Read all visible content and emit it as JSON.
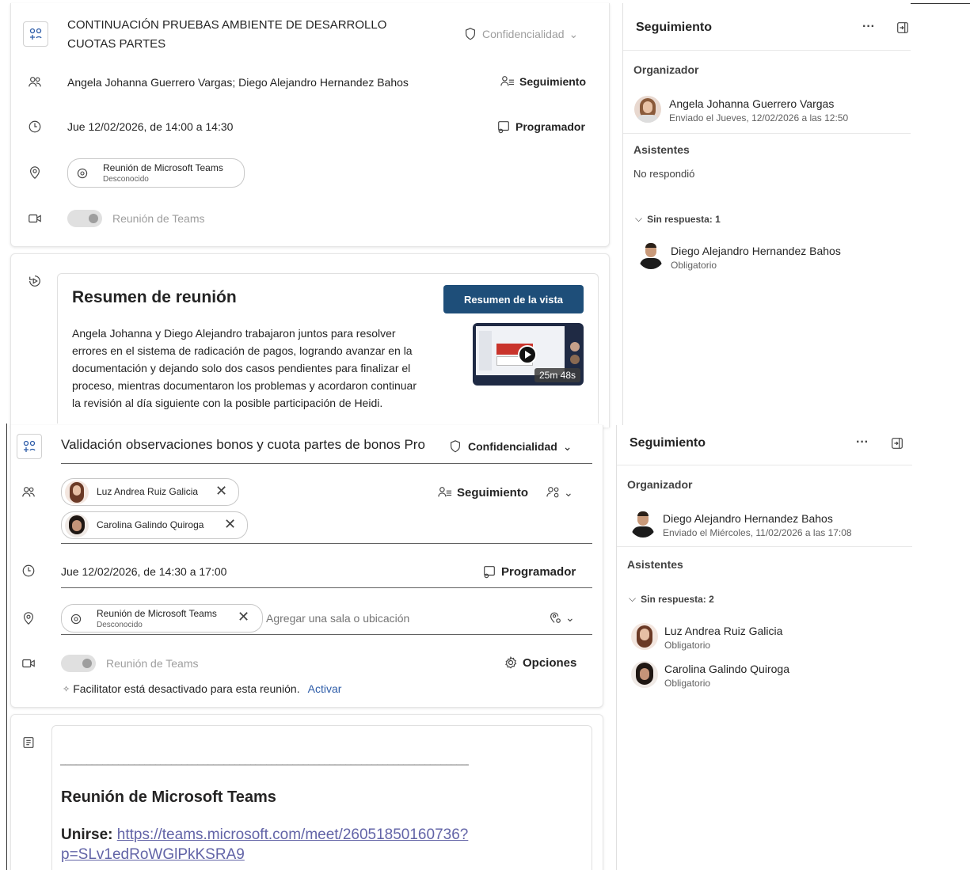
{
  "top": {
    "title_line1": "CONTINUACIÓN PRUEBAS AMBIENTE DE DESARROLLO",
    "title_line2": "CUOTAS PARTES",
    "confidentiality": "Confidencialidad",
    "attendees": "Angela Johanna Guerrero Vargas;  Diego Alejandro Hernandez Bahos",
    "tracking_btn": "Seguimiento",
    "datetime": "Jue 12/02/2026, de 14:00 a 14:30",
    "scheduler_btn": "Programador",
    "location_name": "Reunión de Microsoft Teams",
    "location_status": "Desconocido",
    "teams_toggle_label": "Reunión de Teams"
  },
  "summary": {
    "heading": "Resumen de reunión",
    "view_btn": "Resumen de la vista",
    "lines": [
      "Angela Johanna y Diego Alejandro trabajaron juntos para resolver",
      "errores en el sistema de radicación de pagos, logrando avanzar en la",
      "documentación y dejando solo dos casos pendientes para finalizar el",
      "proceso, mientras documentaron los problemas y acordaron continuar",
      "la revisión al día siguiente con la posible participación de Heidi."
    ],
    "video_duration": "25m 48s"
  },
  "top_panel": {
    "title": "Seguimiento",
    "more": "···",
    "organizer_label": "Organizador",
    "organizer_name": "Angela Johanna Guerrero Vargas",
    "organizer_sent": "Enviado el Jueves, 12/02/2026 a las 12:50",
    "attendees_label": "Asistentes",
    "no_response": "No respondió",
    "group_label": "Sin respuesta: 1",
    "attendee_name": "Diego Alejandro Hernandez Bahos",
    "attendee_role": "Obligatorio"
  },
  "bottom": {
    "title": "Validación observaciones bonos y cuota partes de bonos Pro",
    "confidentiality": "Confidencialidad",
    "attendee1": "Luz Andrea Ruiz Galicia",
    "attendee2": "Carolina Galindo Quiroga",
    "tracking_btn": "Seguimiento",
    "datetime": "Jue 12/02/2026, de 14:30 a 17:00",
    "scheduler_btn": "Programador",
    "location_name": "Reunión de Microsoft Teams",
    "location_status": "Desconocido",
    "location_placeholder": "Agregar una sala o ubicación",
    "teams_toggle_label": "Reunión de Teams",
    "options_btn": "Opciones",
    "facilitator_text": "Facilitator está desactivado para esta reunión.",
    "facilitator_link": "Activar",
    "body_divider": "________________________________________________________________________________",
    "body_heading": "Reunión de Microsoft Teams",
    "join_label": "Unirse:",
    "join_link_1": "https://teams.microsoft.com/meet/26051850160736?",
    "join_link_2": "p=SLv1edRoWGlPkKSRA9"
  },
  "bottom_panel": {
    "title": "Seguimiento",
    "more": "···",
    "organizer_label": "Organizador",
    "organizer_name": "Diego Alejandro Hernandez Bahos",
    "organizer_sent": "Enviado el Miércoles, 11/02/2026 a las 17:08",
    "attendees_label": "Asistentes",
    "group_label": "Sin respuesta: 2",
    "attendee1_name": "Luz Andrea Ruiz Galicia",
    "attendee1_role": "Obligatorio",
    "attendee2_name": "Carolina Galindo Quiroga",
    "attendee2_role": "Obligatorio"
  },
  "colors": {
    "accent": "#1e4e79",
    "link": "#2d5ca8",
    "text": "#242424"
  }
}
